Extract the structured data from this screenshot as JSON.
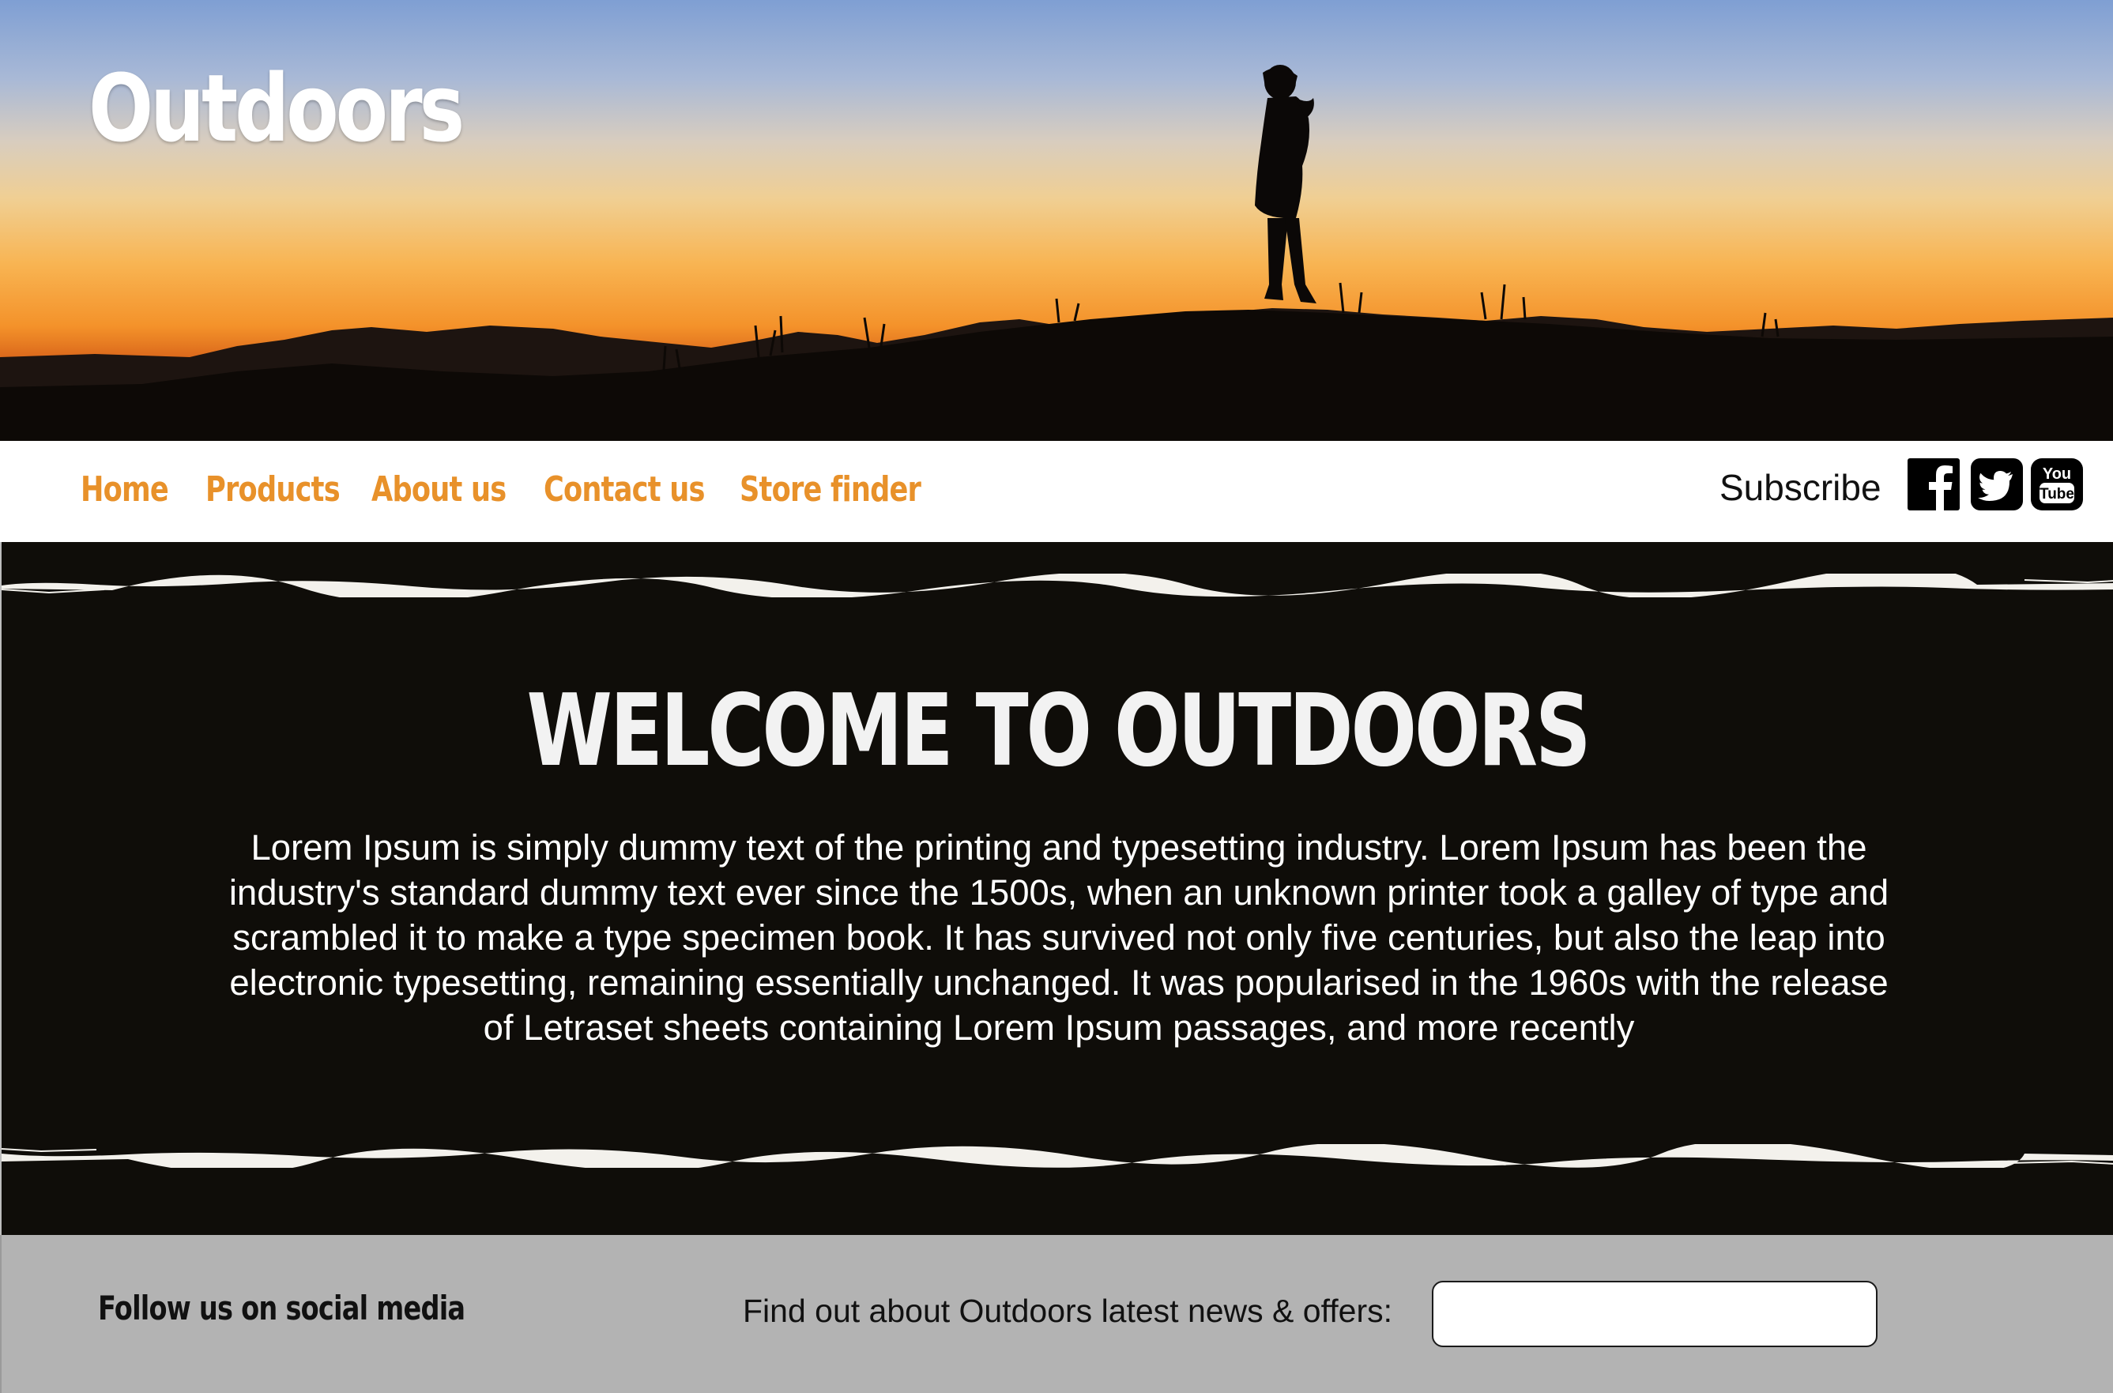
{
  "brand": {
    "name": "Outdoors"
  },
  "nav": {
    "items": [
      {
        "label": "Home"
      },
      {
        "label": "Products"
      },
      {
        "label": "About us"
      },
      {
        "label": "Contact us"
      },
      {
        "label": "Store finder"
      }
    ],
    "subscribe_label": "Subscribe",
    "social_icons": [
      "facebook-icon",
      "twitter-icon",
      "youtube-icon"
    ],
    "youtube_top": "You",
    "youtube_bottom": "Tube"
  },
  "hero": {
    "heading": "WELCOME TO OUTDOORS",
    "body": "Lorem Ipsum is simply dummy text of the printing and typesetting industry. Lorem Ipsum has been the industry's standard dummy text ever since the 1500s, when an unknown printer took a galley of type and scrambled it to make a type specimen book. It has survived not only five centuries, but also the leap into electronic typesetting, remaining essentially unchanged. It was popularised in the 1960s with the release of Letraset sheets containing Lorem Ipsum passages, and more recently"
  },
  "footer": {
    "follow_label": "Follow us on social media",
    "news_label": "Find out about Outdoors latest news & offers:",
    "email_value": "",
    "email_placeholder": ""
  },
  "colors": {
    "accent": "#e8912a",
    "band": "#0f0d09",
    "footer": "#b3b3b3"
  }
}
